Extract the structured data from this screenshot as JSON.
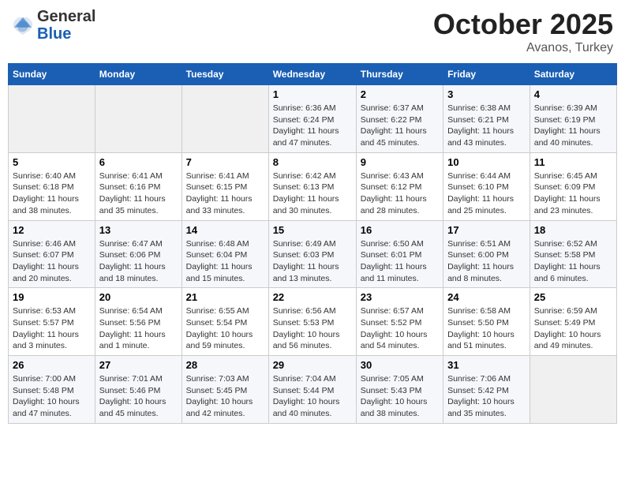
{
  "header": {
    "logo_line1": "General",
    "logo_line2": "Blue",
    "month": "October 2025",
    "location": "Avanos, Turkey"
  },
  "weekdays": [
    "Sunday",
    "Monday",
    "Tuesday",
    "Wednesday",
    "Thursday",
    "Friday",
    "Saturday"
  ],
  "weeks": [
    [
      {
        "day": "",
        "info": ""
      },
      {
        "day": "",
        "info": ""
      },
      {
        "day": "",
        "info": ""
      },
      {
        "day": "1",
        "info": "Sunrise: 6:36 AM\nSunset: 6:24 PM\nDaylight: 11 hours and 47 minutes."
      },
      {
        "day": "2",
        "info": "Sunrise: 6:37 AM\nSunset: 6:22 PM\nDaylight: 11 hours and 45 minutes."
      },
      {
        "day": "3",
        "info": "Sunrise: 6:38 AM\nSunset: 6:21 PM\nDaylight: 11 hours and 43 minutes."
      },
      {
        "day": "4",
        "info": "Sunrise: 6:39 AM\nSunset: 6:19 PM\nDaylight: 11 hours and 40 minutes."
      }
    ],
    [
      {
        "day": "5",
        "info": "Sunrise: 6:40 AM\nSunset: 6:18 PM\nDaylight: 11 hours and 38 minutes."
      },
      {
        "day": "6",
        "info": "Sunrise: 6:41 AM\nSunset: 6:16 PM\nDaylight: 11 hours and 35 minutes."
      },
      {
        "day": "7",
        "info": "Sunrise: 6:41 AM\nSunset: 6:15 PM\nDaylight: 11 hours and 33 minutes."
      },
      {
        "day": "8",
        "info": "Sunrise: 6:42 AM\nSunset: 6:13 PM\nDaylight: 11 hours and 30 minutes."
      },
      {
        "day": "9",
        "info": "Sunrise: 6:43 AM\nSunset: 6:12 PM\nDaylight: 11 hours and 28 minutes."
      },
      {
        "day": "10",
        "info": "Sunrise: 6:44 AM\nSunset: 6:10 PM\nDaylight: 11 hours and 25 minutes."
      },
      {
        "day": "11",
        "info": "Sunrise: 6:45 AM\nSunset: 6:09 PM\nDaylight: 11 hours and 23 minutes."
      }
    ],
    [
      {
        "day": "12",
        "info": "Sunrise: 6:46 AM\nSunset: 6:07 PM\nDaylight: 11 hours and 20 minutes."
      },
      {
        "day": "13",
        "info": "Sunrise: 6:47 AM\nSunset: 6:06 PM\nDaylight: 11 hours and 18 minutes."
      },
      {
        "day": "14",
        "info": "Sunrise: 6:48 AM\nSunset: 6:04 PM\nDaylight: 11 hours and 15 minutes."
      },
      {
        "day": "15",
        "info": "Sunrise: 6:49 AM\nSunset: 6:03 PM\nDaylight: 11 hours and 13 minutes."
      },
      {
        "day": "16",
        "info": "Sunrise: 6:50 AM\nSunset: 6:01 PM\nDaylight: 11 hours and 11 minutes."
      },
      {
        "day": "17",
        "info": "Sunrise: 6:51 AM\nSunset: 6:00 PM\nDaylight: 11 hours and 8 minutes."
      },
      {
        "day": "18",
        "info": "Sunrise: 6:52 AM\nSunset: 5:58 PM\nDaylight: 11 hours and 6 minutes."
      }
    ],
    [
      {
        "day": "19",
        "info": "Sunrise: 6:53 AM\nSunset: 5:57 PM\nDaylight: 11 hours and 3 minutes."
      },
      {
        "day": "20",
        "info": "Sunrise: 6:54 AM\nSunset: 5:56 PM\nDaylight: 11 hours and 1 minute."
      },
      {
        "day": "21",
        "info": "Sunrise: 6:55 AM\nSunset: 5:54 PM\nDaylight: 10 hours and 59 minutes."
      },
      {
        "day": "22",
        "info": "Sunrise: 6:56 AM\nSunset: 5:53 PM\nDaylight: 10 hours and 56 minutes."
      },
      {
        "day": "23",
        "info": "Sunrise: 6:57 AM\nSunset: 5:52 PM\nDaylight: 10 hours and 54 minutes."
      },
      {
        "day": "24",
        "info": "Sunrise: 6:58 AM\nSunset: 5:50 PM\nDaylight: 10 hours and 51 minutes."
      },
      {
        "day": "25",
        "info": "Sunrise: 6:59 AM\nSunset: 5:49 PM\nDaylight: 10 hours and 49 minutes."
      }
    ],
    [
      {
        "day": "26",
        "info": "Sunrise: 7:00 AM\nSunset: 5:48 PM\nDaylight: 10 hours and 47 minutes."
      },
      {
        "day": "27",
        "info": "Sunrise: 7:01 AM\nSunset: 5:46 PM\nDaylight: 10 hours and 45 minutes."
      },
      {
        "day": "28",
        "info": "Sunrise: 7:03 AM\nSunset: 5:45 PM\nDaylight: 10 hours and 42 minutes."
      },
      {
        "day": "29",
        "info": "Sunrise: 7:04 AM\nSunset: 5:44 PM\nDaylight: 10 hours and 40 minutes."
      },
      {
        "day": "30",
        "info": "Sunrise: 7:05 AM\nSunset: 5:43 PM\nDaylight: 10 hours and 38 minutes."
      },
      {
        "day": "31",
        "info": "Sunrise: 7:06 AM\nSunset: 5:42 PM\nDaylight: 10 hours and 35 minutes."
      },
      {
        "day": "",
        "info": ""
      }
    ]
  ]
}
